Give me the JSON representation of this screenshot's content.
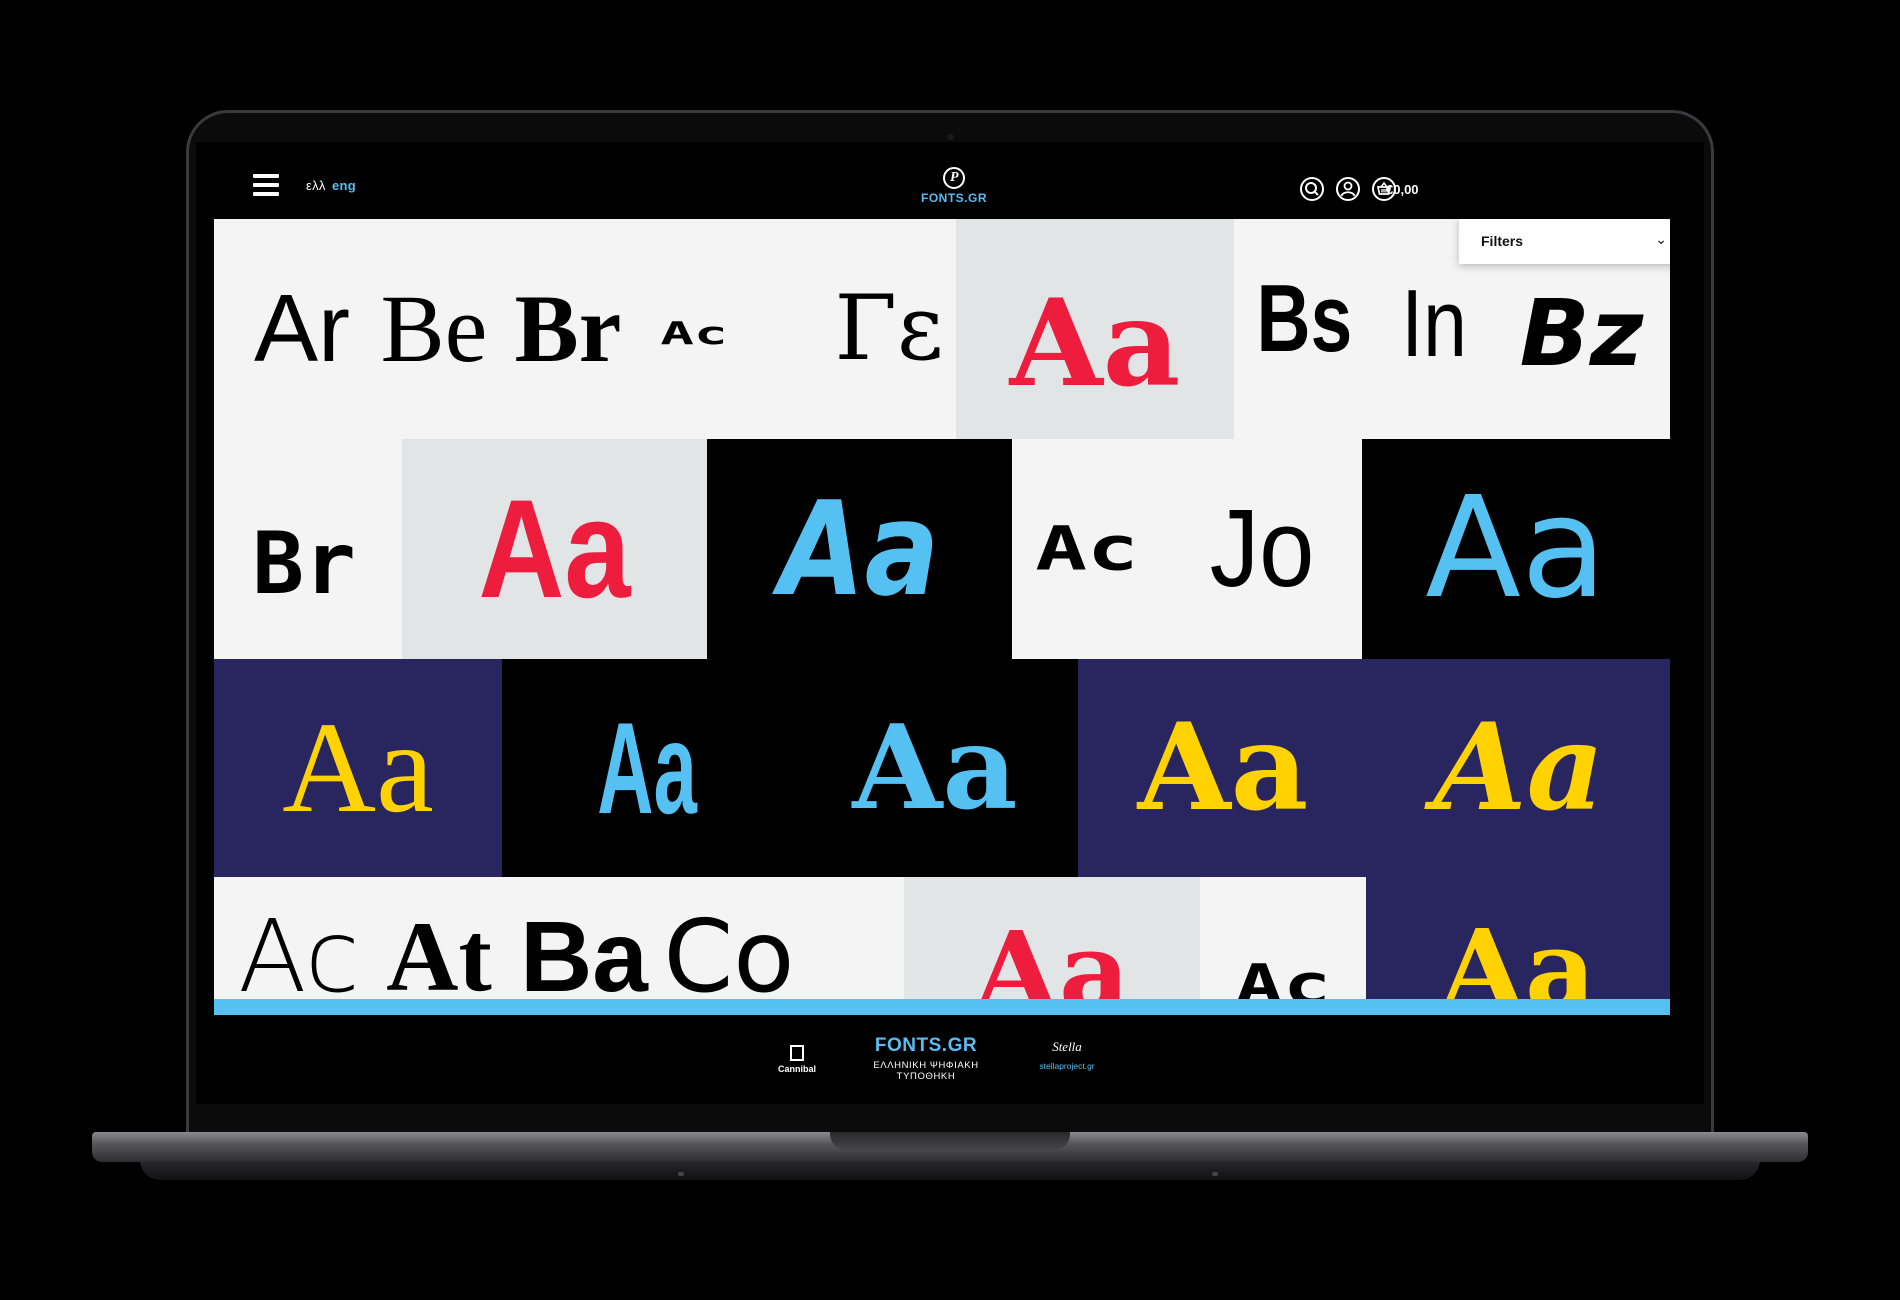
{
  "header": {
    "lang_greek": "ελλ",
    "lang_english": "eng",
    "logo_text": "FONTS.GR",
    "logo_glyph": "P",
    "cart_total": "€0,00"
  },
  "filters": {
    "label": "Filters",
    "chevron": "⌄"
  },
  "specimens": {
    "row1": [
      "Ar",
      "Be",
      "Br",
      "Ac",
      "Γε",
      "Aa",
      "Bs",
      "In",
      "Bz"
    ],
    "row2": [
      "Br",
      "Aa",
      "Aa",
      "Ac",
      "Jo",
      "Aa"
    ],
    "row3": [
      "Aa",
      "Aa",
      "Aa",
      "Aa",
      "Aa"
    ],
    "row4": [
      "Ac",
      "At",
      "Ba",
      "Co",
      "Aa",
      "Ac",
      "Aa"
    ]
  },
  "footer": {
    "cannibal": "Cannibal",
    "fonts_title": "FONTS.GR",
    "fonts_subtitle": "ΕΛΛΗΝΙΚΗ ΨΗΦΙΑΚΗ ΤΥΠΟΘΗΚΗ",
    "stella_signature": "Stella",
    "stella_url": "stellaproject.gr"
  },
  "colors": {
    "accent_blue": "#55c0f2",
    "accent_red": "#ee1c3d",
    "accent_yellow": "#ffd200",
    "navy": "#29265f",
    "light_grey": "#f4f4f4",
    "mid_grey": "#e2e5e6"
  }
}
